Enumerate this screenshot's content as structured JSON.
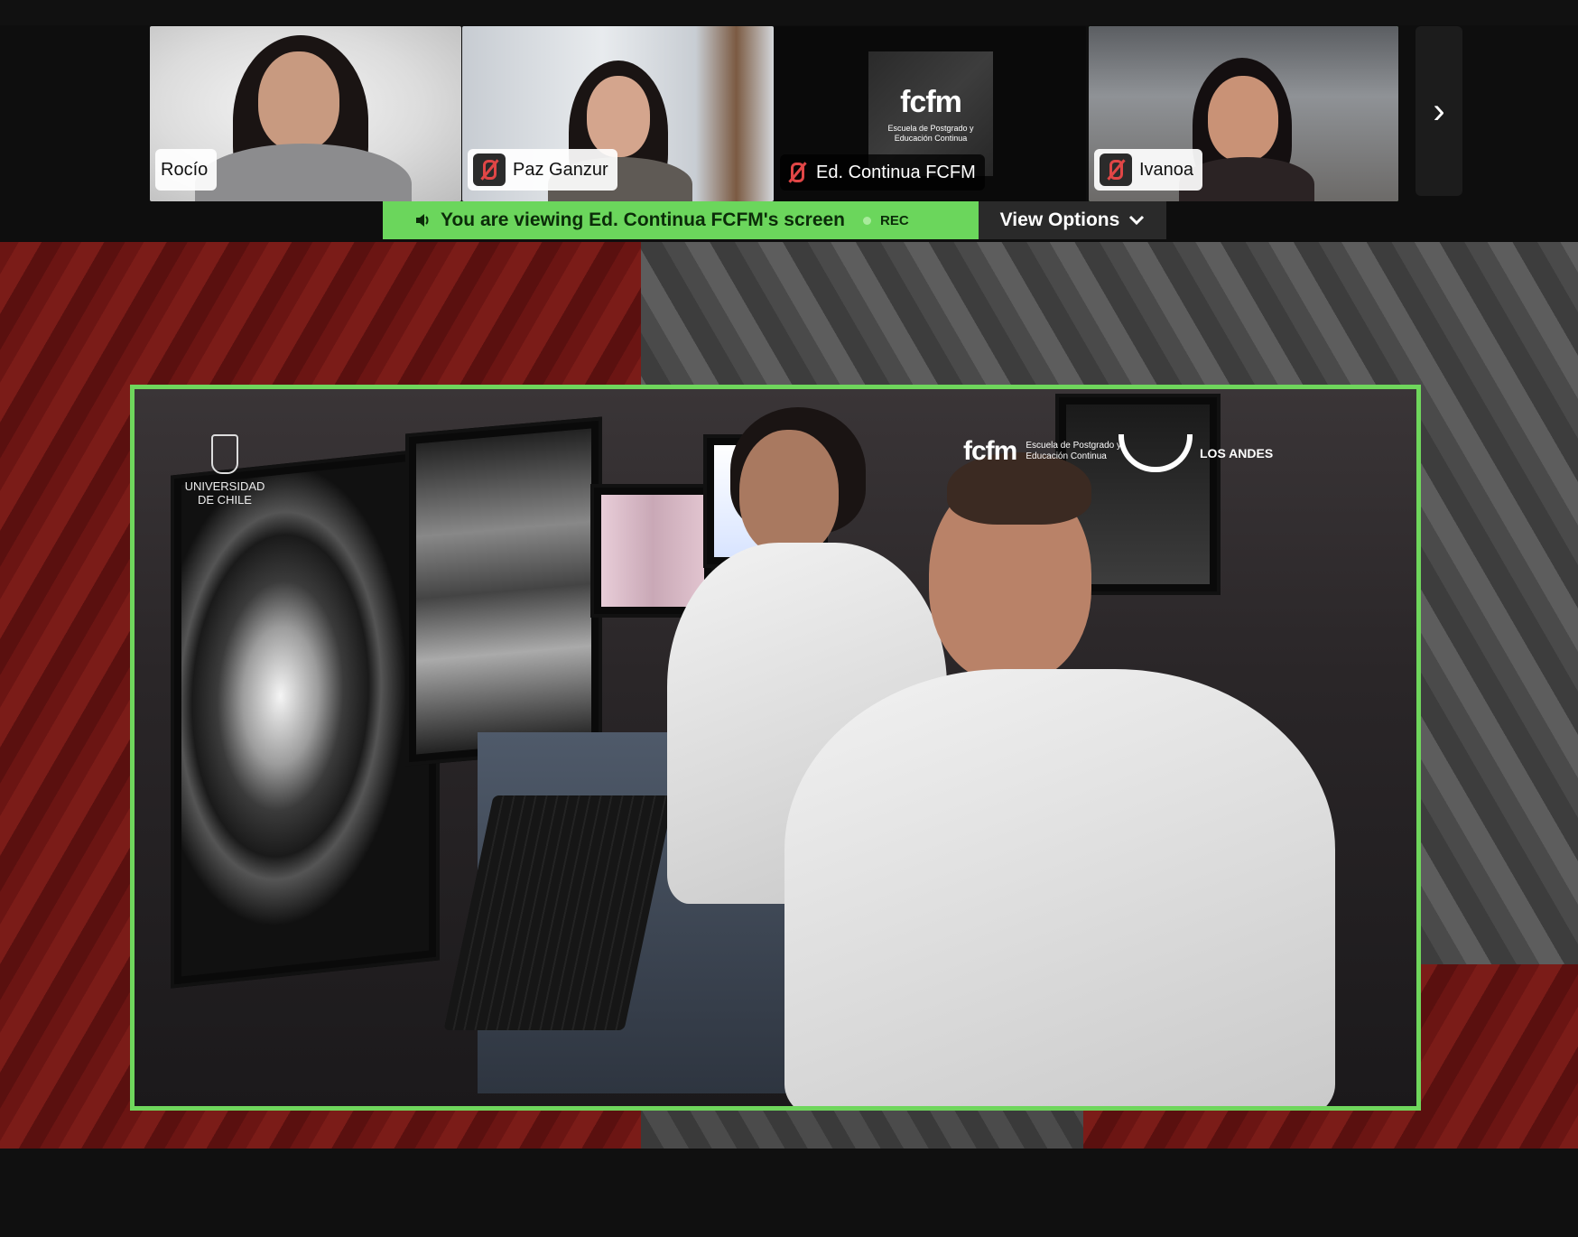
{
  "participants": [
    {
      "name": "Rocío",
      "muted": false
    },
    {
      "name": "Paz Ganzur",
      "muted": true
    },
    {
      "name": "Ed. Continua FCFM",
      "muted": true,
      "logo_big": "fcfm",
      "logo_small": "Escuela de Postgrado y Educación Continua"
    },
    {
      "name": "Ivanoa",
      "muted": true,
      "active": true
    }
  ],
  "next_icon": "chevron-right-icon",
  "share_banner": {
    "text": "You are viewing  Ed. Continua FCFM's screen",
    "rec": "REC",
    "view_options": "View Options"
  },
  "video_overlay": {
    "uchile": "UNIVERSIDAD DE CHILE",
    "fcfm_big": "fcfm",
    "fcfm_small": "Escuela de Postgrado y Educación Continua",
    "andes": "LOS ANDES"
  },
  "colors": {
    "active_speaker": "#6fd65c",
    "banner_bg": "#6bd65c",
    "muted_red": "#e04646"
  }
}
